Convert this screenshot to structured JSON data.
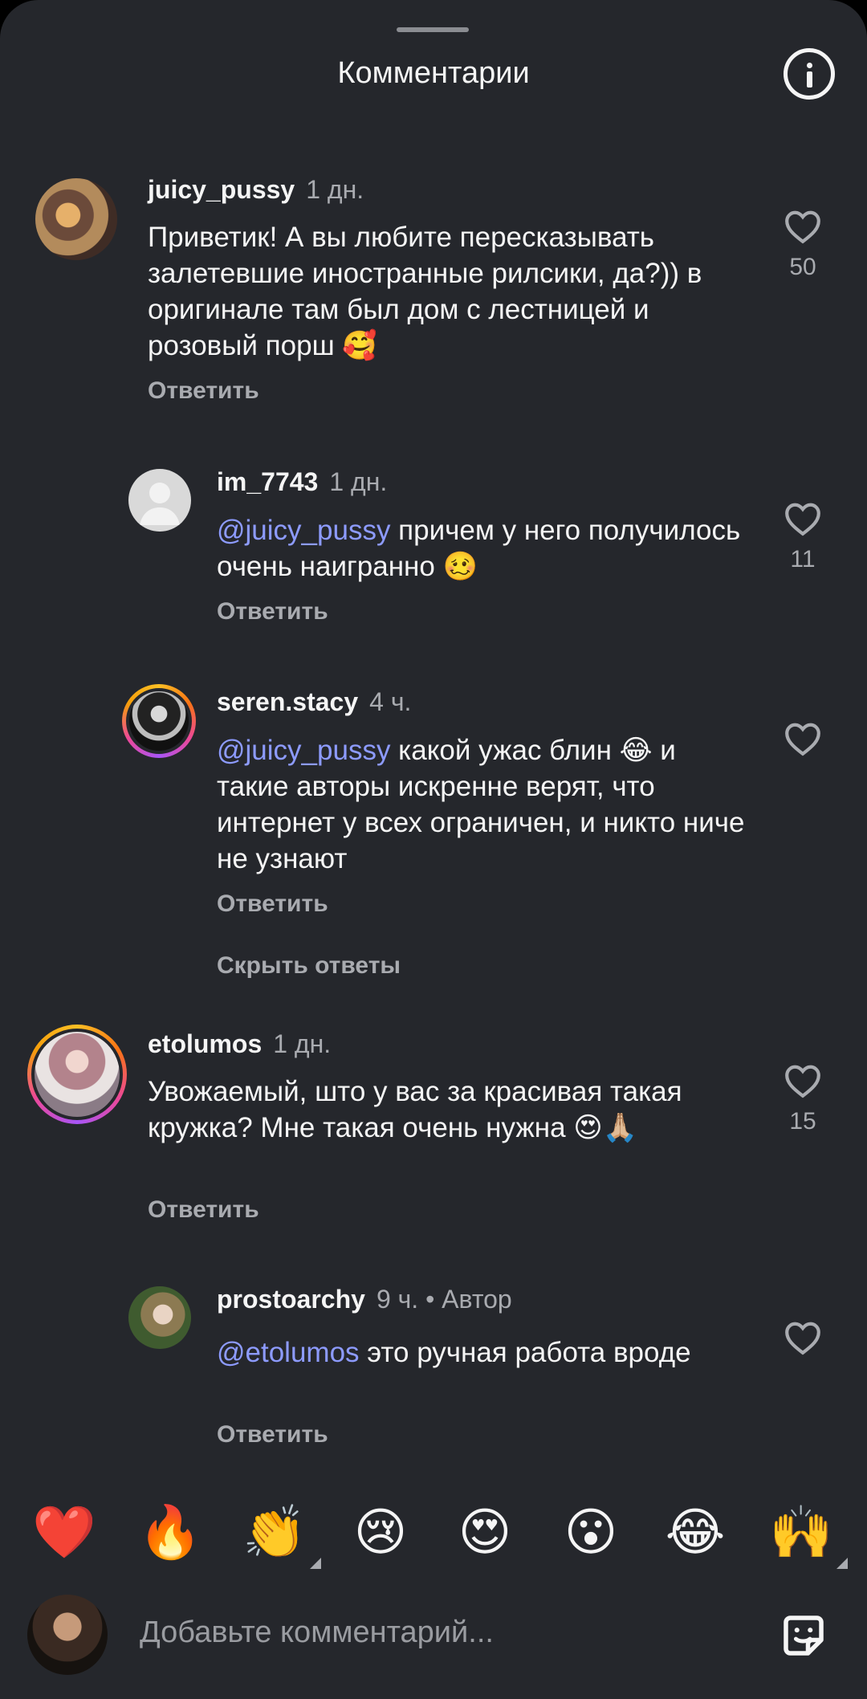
{
  "header": {
    "title": "Комментарии"
  },
  "comments": [
    {
      "user": "juicy_pussy",
      "time": "1 дн.",
      "text": "Приветик! А вы любите пересказывать залетевшие иностранные рилсики, да?)) в оригинале там был дом с лестницей и розовый порш 🥰",
      "reply_label": "Ответить",
      "likes": "50"
    },
    {
      "user": "im_7743",
      "time": "1 дн.",
      "mention": "@juicy_pussy",
      "text": " причем у него получилось очень наигранно 🥴",
      "reply_label": "Ответить",
      "likes": "11"
    },
    {
      "user": "seren.stacy",
      "time": "4 ч.",
      "mention": "@juicy_pussy",
      "text": " какой ужас блин 😂 и такие авторы  искренне верят, что интернет у всех ограничен, и никто ниче не узнают",
      "reply_label": "Ответить",
      "likes": ""
    },
    {
      "user": "etolumos",
      "time": "1 дн.",
      "text": "Увожаемый, што у вас за красивая такая кружка? Мне такая очень нужна 😍🙏🏼",
      "reply_label": "Ответить",
      "likes": "15"
    },
    {
      "user": "prostoarchy",
      "time": "9 ч.",
      "author_badge": " • Автор",
      "mention": "@etolumos",
      "text": " это ручная работа вроде",
      "reply_label": "Ответить",
      "likes": ""
    }
  ],
  "hide_replies_label": "Скрыть ответы",
  "emoji_bar": [
    "❤️",
    "🔥",
    "👏",
    "😢",
    "😍",
    "😮",
    "😂",
    "🙌"
  ],
  "composer": {
    "placeholder": "Добавьте комментарий..."
  },
  "icons": {
    "info": "info-icon",
    "heart": "heart-outline-icon",
    "sticker": "sticker-icon"
  },
  "colors": {
    "background": "#25272c",
    "mention": "#8d9bff",
    "muted": "#a9abb0"
  }
}
